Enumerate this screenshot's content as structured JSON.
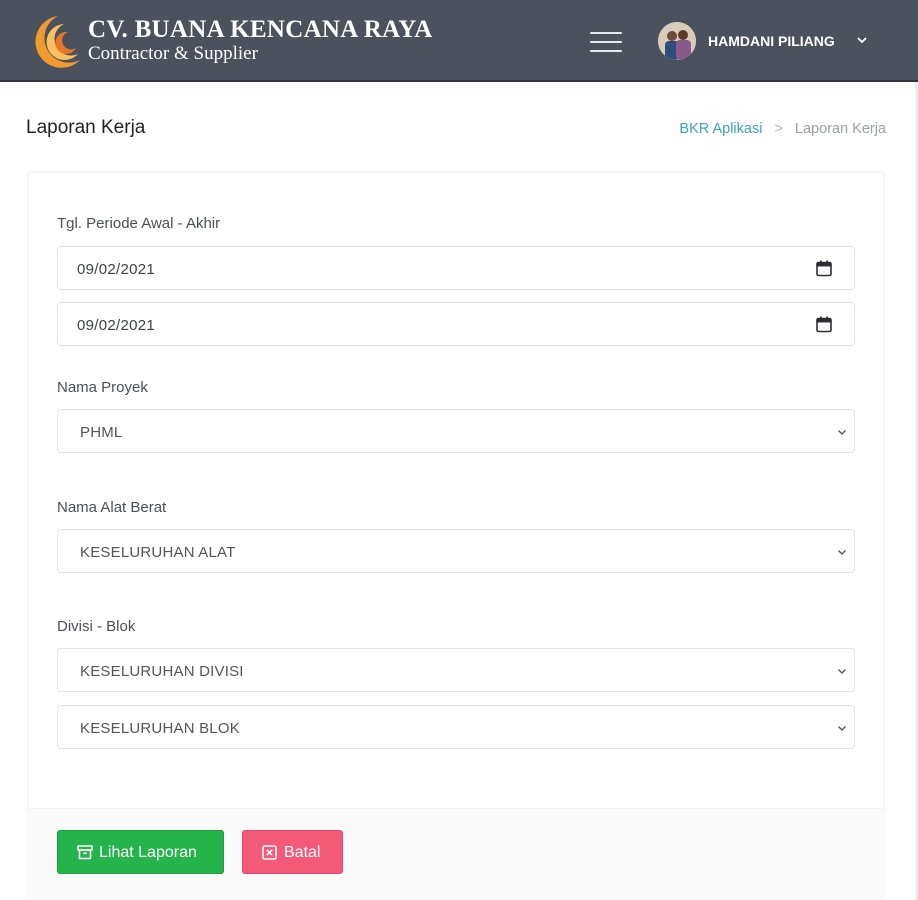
{
  "header": {
    "brand_title": "CV. BUANA KENCANA RAYA",
    "brand_subtitle": "Contractor & Supplier",
    "logo_icon": "crescent-logo-icon",
    "menu_icon": "hamburger-menu-icon",
    "user_name": "HAMDANI PILIANG",
    "user_caret_icon": "chevron-down-icon",
    "background_color": "#4b515d"
  },
  "page": {
    "title": "Laporan Kerja",
    "breadcrumb": {
      "home": "BKR Aplikasi",
      "separator": ">",
      "current": "Laporan Kerja"
    }
  },
  "form": {
    "periode": {
      "label": "Tgl. Periode Awal - Akhir",
      "start_value": "09/02/2021",
      "end_value": "09/02/2021",
      "icon": "calendar-icon"
    },
    "proyek": {
      "label": "Nama Proyek",
      "selected": "PHML"
    },
    "alat_berat": {
      "label": "Nama Alat Berat",
      "selected": "KESELURUHAN ALAT"
    },
    "divisi_blok": {
      "label": "Divisi - Blok",
      "divisi_selected": "KESELURUHAN DIVISI",
      "blok_selected": "KESELURUHAN BLOK"
    }
  },
  "actions": {
    "view_label": "Lihat Laporan",
    "view_icon": "archive-icon",
    "view_color": "#25b34b",
    "cancel_label": "Batal",
    "cancel_icon": "close-square-icon",
    "cancel_color": "#f25a78"
  }
}
